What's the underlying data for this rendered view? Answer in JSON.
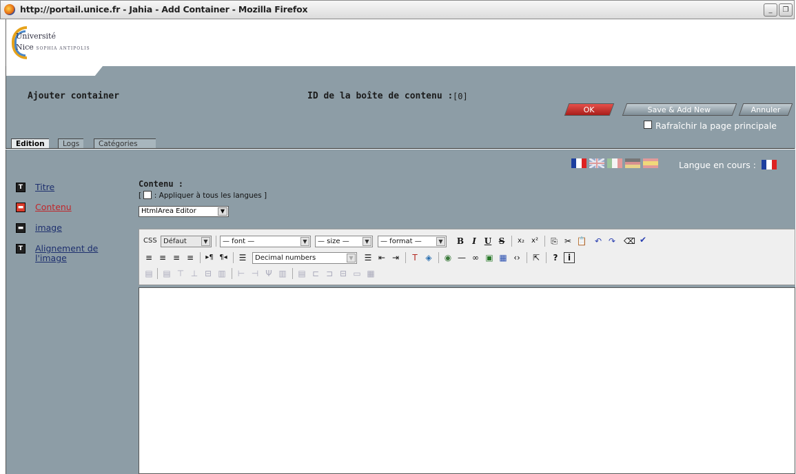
{
  "window": {
    "title": "http://portail.unice.fr - Jahia - Add Container - Mozilla Firefox",
    "minimize_label": "_",
    "restore_label": "❐"
  },
  "logo": {
    "line1": "Université",
    "line2": "Nice",
    "line2_small": "SOPHIA ANTIPOLIS"
  },
  "header": {
    "title": "Ajouter container",
    "id_label": "ID de la boîte de contenu :",
    "id_value": "[0]",
    "ok_label": "OK",
    "save_new_label": "Save & Add New",
    "cancel_label": "Annuler",
    "refresh_label": "Rafraîchir la page principale"
  },
  "tabs": [
    {
      "label": "Edition",
      "active": true
    },
    {
      "label": "Logs",
      "active": false
    },
    {
      "label": "Catégories",
      "active": false
    }
  ],
  "language": {
    "label": "Langue en cours :"
  },
  "nav": [
    {
      "label": "Titre",
      "icon": "T",
      "active": false
    },
    {
      "label": "Contenu",
      "icon": "▬",
      "active": true
    },
    {
      "label": "image",
      "icon": "▬",
      "active": false
    },
    {
      "label": "Alignement de l'image",
      "icon": "T",
      "active": false
    }
  ],
  "content": {
    "title": "Contenu :",
    "apply_open": "[",
    "apply_label": ": Appliquer à tous les langues",
    "apply_close": "]",
    "editor_select": "HtmlArea Editor"
  },
  "toolbar": {
    "css_label": "CSS",
    "css_value": "Défaut",
    "font_value": "— font —",
    "size_value": "— size —",
    "format_value": "— format —",
    "list_value": "Decimal numbers"
  }
}
